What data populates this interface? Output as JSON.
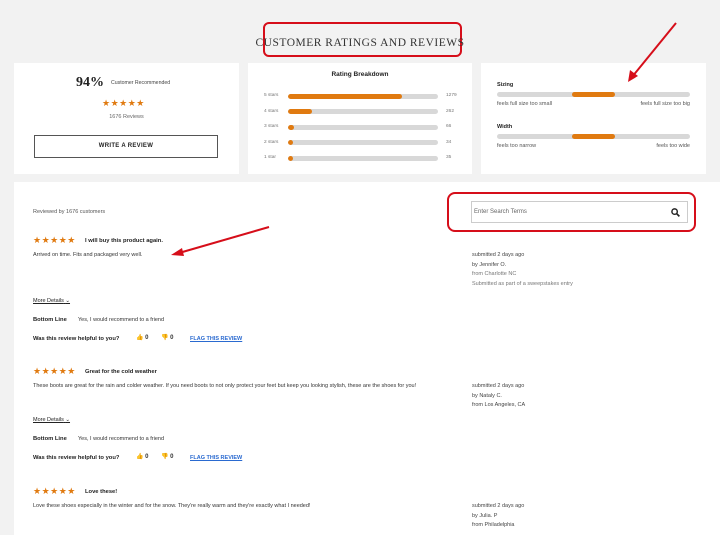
{
  "header": {
    "title": "CUSTOMER RATINGS AND REVIEWS"
  },
  "summary": {
    "percent": "94%",
    "percent_label": "Customer Recommended",
    "stars": "★★★★★",
    "review_count": "1676 Reviews",
    "write_button": "WRITE A REVIEW",
    "rating_value": 4.6
  },
  "breakdown": {
    "title": "Rating Breakdown",
    "rows": [
      {
        "label": "5 stars",
        "count": "1279",
        "fraction": 0.76
      },
      {
        "label": "4 stars",
        "count": "262",
        "fraction": 0.16
      },
      {
        "label": "3 stars",
        "count": "66",
        "fraction": 0.04
      },
      {
        "label": "2 stars",
        "count": "34",
        "fraction": 0.02
      },
      {
        "label": "1 star",
        "count": "35",
        "fraction": 0.02
      }
    ]
  },
  "fit": {
    "sizing": {
      "title": "Sizing",
      "left": "feels full size too small",
      "right": "feels full size too big",
      "marker_start": 0.39,
      "marker_end": 0.61
    },
    "width": {
      "title": "Width",
      "left": "feels too narrow",
      "right": "feels too wide",
      "marker_start": 0.39,
      "marker_end": 0.61
    }
  },
  "reviews_header": {
    "reviewed_by": "Reviewed by 1676 customers",
    "search_placeholder": "Enter Search Terms"
  },
  "reviews": [
    {
      "stars": "★★★★★",
      "title": "I will buy this product again.",
      "body": "Arrived on time. Fits and packaged very well.",
      "submitted": "submitted 2 days ago",
      "by": "by Jennifer O.",
      "from": "from Charlotte NC",
      "note": "Submitted as part of a sweepstakes entry",
      "more_details": "More Details",
      "bottom_line_label": "Bottom Line",
      "bottom_line": "Yes, I would recommend to a friend",
      "helpful_label": "Was this review helpful to you?",
      "up_count": "0",
      "down_count": "0",
      "flag": "FLAG THIS REVIEW"
    },
    {
      "stars": "★★★★★",
      "title": "Great for the cold weather",
      "body": "These boots are great for the rain and colder weather. If you need boots to not only protect your feet but keep you looking stylish, these are the shoes for you!",
      "submitted": "submitted 2 days ago",
      "by": "by Nataly C.",
      "from": "from Los Angeles, CA",
      "more_details": "More Details",
      "bottom_line_label": "Bottom Line",
      "bottom_line": "Yes, I would recommend to a friend",
      "helpful_label": "Was this review helpful to you?",
      "up_count": "0",
      "down_count": "0",
      "flag": "FLAG THIS REVIEW"
    },
    {
      "stars": "★★★★★",
      "title": "Love these!",
      "body": "Love these shoes especially in the winter and for the snow. They're really warm and they're exactly what I needed!",
      "submitted": "submitted 2 days ago",
      "by": "by Julia. P",
      "from": "from Philadelphia"
    }
  ],
  "colors": {
    "accent": "#e07a10",
    "annotation": "#d60e1a",
    "link": "#2a6ad0"
  },
  "icons": {
    "search": "search-icon",
    "thumb_up": "thumbs-up-icon",
    "thumb_down": "thumbs-down-icon",
    "chevron": "chevron-down-icon"
  }
}
